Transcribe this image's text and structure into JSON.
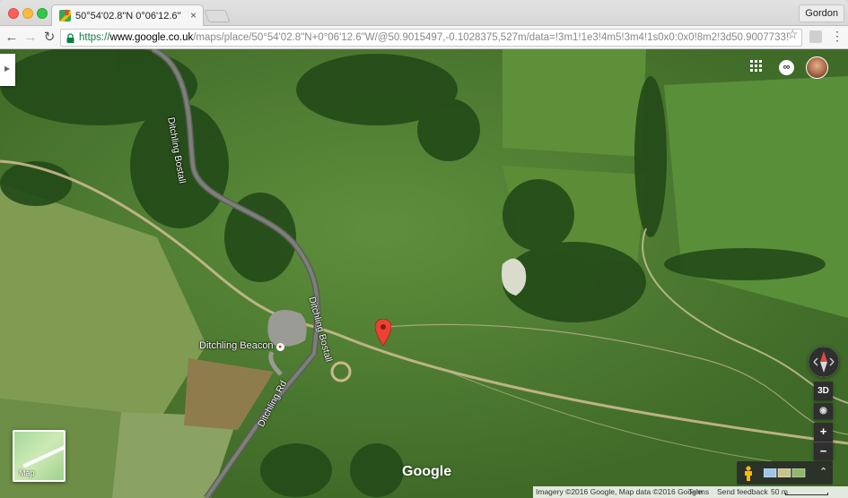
{
  "browser": {
    "tab_title": "50°54'02.8\"N 0°06'12.6\"W - G",
    "profile_name": "Gordon",
    "url_scheme": "https://",
    "url_host": "www.google.co.uk",
    "url_path": "/maps/place/50°54'02.8\"N+0°06'12.6\"W/@50.9015497,-0.1028375,527m/data=!3m1!1e3!4m5!3m4!1s0x0:0x0!8m2!3d50.9007733!4d-0...."
  },
  "map": {
    "place_label": "Ditchling Beacon",
    "road_labels": [
      "Ditchling Bostall",
      "Ditchling Bostall",
      "Ditchling Rd"
    ],
    "logo": "Google",
    "minimap_label": "Map",
    "controls": {
      "three_d": "3D",
      "zoom_in": "+",
      "zoom_out": "−",
      "expand": "⌃"
    },
    "footer": {
      "imagery": "Imagery ©2016 Google, Map data ©2016 Google",
      "terms": "Terms",
      "feedback": "Send feedback",
      "scale": "50 m"
    },
    "colors": {
      "pin": "#ea4335",
      "secure": "#0b8043"
    }
  }
}
